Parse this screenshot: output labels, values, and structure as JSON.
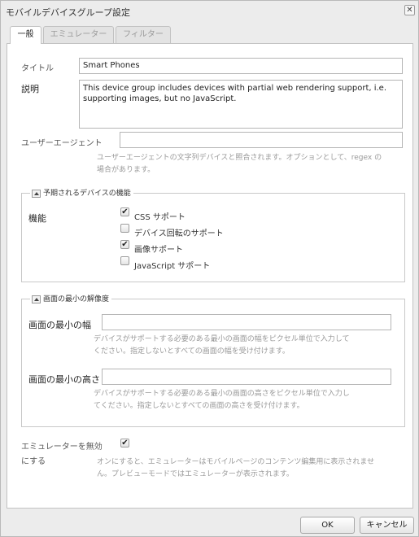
{
  "window": {
    "title": "モバイルデバイスグループ設定",
    "close_glyph": "✕"
  },
  "tabs": [
    {
      "label": "一般"
    },
    {
      "label": "エミュレーター"
    },
    {
      "label": "フィルター"
    }
  ],
  "general": {
    "title_label": "タイトル",
    "title_value": "Smart Phones",
    "description_label": "説明",
    "description_value": "This device group includes devices with partial web rendering support, i.e. supporting images, but no JavaScript.",
    "user_agent_label": "ユーザーエージェント",
    "user_agent_value": "",
    "user_agent_help_1": "ユーザーエージェントの文字列デバイスと照合されます。オプションとして、regex の",
    "user_agent_help_2": "場合があります。"
  },
  "capabilities": {
    "legend": "予期されるデバイスの機能",
    "label": "機能",
    "items": [
      {
        "label": "CSS サポート",
        "checked": true
      },
      {
        "label": "デバイス回転のサポート",
        "checked": false
      },
      {
        "label": "画像サポート",
        "checked": true
      },
      {
        "label": "JavaScript サポート",
        "checked": false
      }
    ]
  },
  "resolution": {
    "legend": "画面の最小の解像度",
    "width_label": "画面の最小の幅",
    "width_value": "",
    "width_help_1": "デバイスがサポートする必要のある最小の画面の幅をピクセル単位で入力して",
    "width_help_2": "ください。指定しないとすべての画面の幅を受け付けます。",
    "height_label": "画面の最小の高さ",
    "height_value": "",
    "height_help_1": "デバイスがサポートする必要のある最小の画面の高さをピクセル単位で入力し",
    "height_help_2": "てください。指定しないとすべての画面の高さを受け付けます。"
  },
  "emulator": {
    "label_1": "エミュレーターを無効",
    "label_2": "にする",
    "checked": true,
    "help_1": "オンにすると、エミュレーターはモバイルページのコンテンツ編集用に表示されませ",
    "help_2": "ん。プレビューモードではエミュレーターが表示されます。"
  },
  "footer": {
    "ok_label": "OK",
    "cancel_label": "キャンセル"
  },
  "check_glyph": "✔"
}
